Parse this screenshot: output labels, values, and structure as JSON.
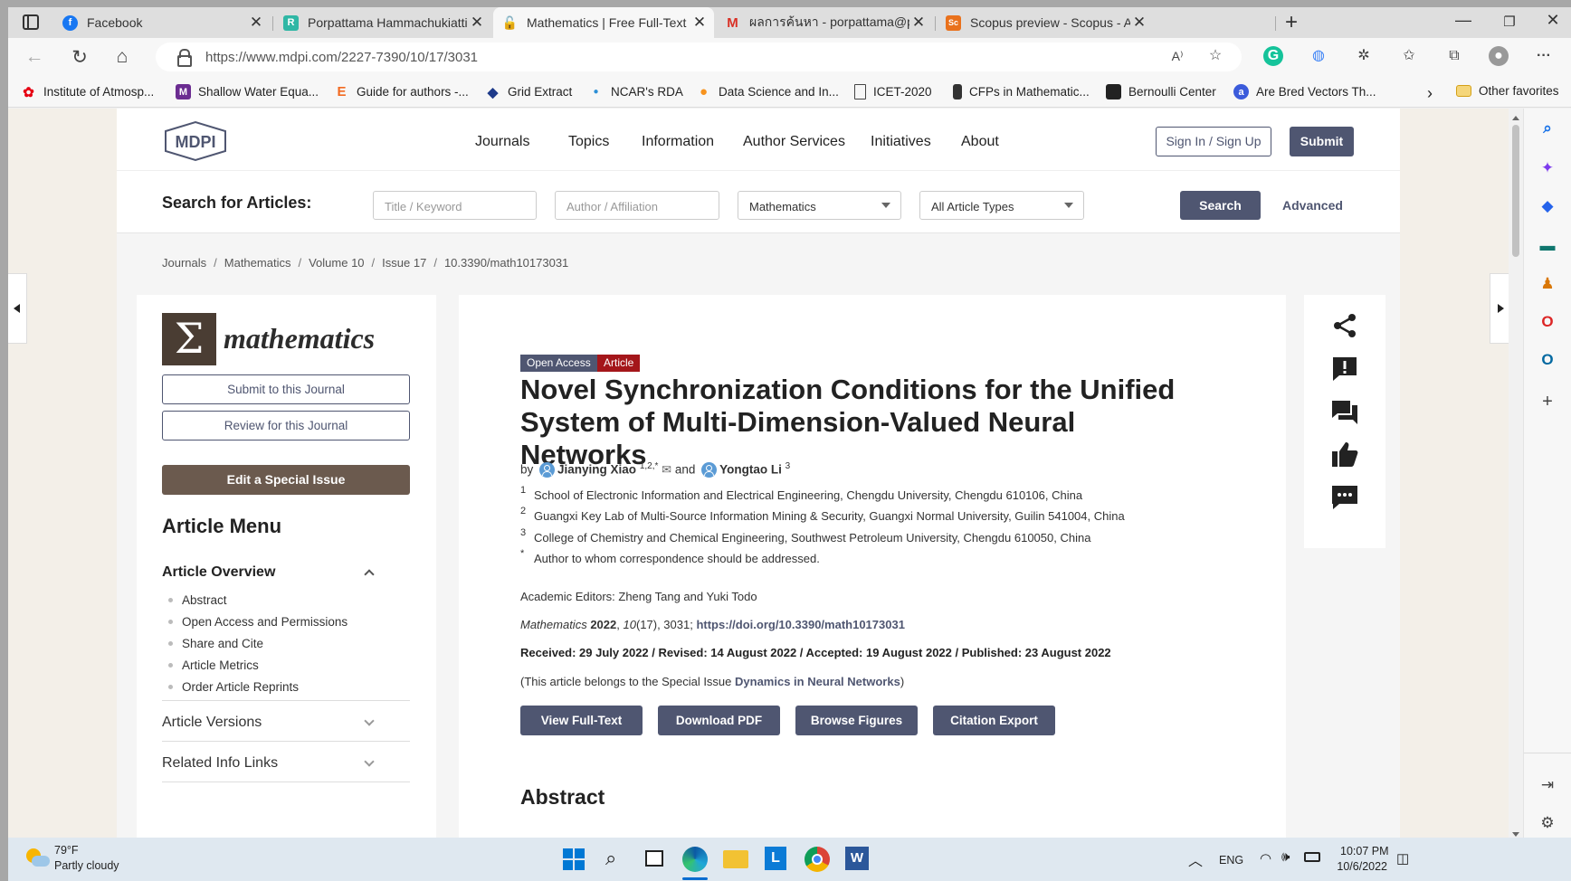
{
  "browser": {
    "tabs": [
      {
        "title": "Facebook",
        "icon": "facebook-icon",
        "color": "#1877f2",
        "glyph": "f"
      },
      {
        "title": "Porpattama Hammachukiattikul |",
        "icon": "researchgate-icon",
        "color": "#2fb7a5",
        "glyph": "R"
      },
      {
        "title": "Mathematics | Free Full-Text | Nc",
        "icon": "page-icon",
        "color": "#555555",
        "glyph": ""
      },
      {
        "title": "ผลการค้นหา - porpattama@pkru.a",
        "icon": "gmail-icon",
        "color": "#d93025",
        "glyph": "M"
      },
      {
        "title": "Scopus preview - Scopus - Advar",
        "icon": "scopus-icon",
        "color": "#e9711c",
        "glyph": "Sc"
      }
    ],
    "url": "https://www.mdpi.com/2227-7390/10/17/3031",
    "favorites": [
      {
        "label": "Institute of Atmosp...",
        "color": "#e60012",
        "glyph": "✿"
      },
      {
        "label": "Shallow Water Equa...",
        "color": "#6b2c91",
        "glyph": "M"
      },
      {
        "label": "Guide for authors -...",
        "color": "#f26a21",
        "glyph": "E"
      },
      {
        "label": "Grid Extract",
        "color": "#1e3a8a",
        "glyph": "◆"
      },
      {
        "label": "NCAR's RDA",
        "color": "#2c8fd6",
        "glyph": "●"
      },
      {
        "label": "Data Science and In...",
        "color": "#f7931e",
        "glyph": "●"
      },
      {
        "label": "ICET-2020",
        "color": "#ffffff",
        "glyph": ""
      },
      {
        "label": "CFPs in Mathematic...",
        "color": "#222222",
        "glyph": ""
      },
      {
        "label": "Bernoulli Center",
        "color": "#222222",
        "glyph": ""
      },
      {
        "label": "Are Bred Vectors Th...",
        "color": "#3b5bdb",
        "glyph": "a"
      }
    ],
    "other_favorites": "Other favorites"
  },
  "site": {
    "brand": "MDPI",
    "nav": [
      "Journals",
      "Topics",
      "Information",
      "Author Services",
      "Initiatives",
      "About"
    ],
    "sign_in": "Sign In / Sign Up",
    "submit": "Submit",
    "search": {
      "label": "Search for Articles:",
      "title_placeholder": "Title / Keyword",
      "author_placeholder": "Author / Affiliation",
      "journal_value": "Mathematics",
      "type_value": "All Article Types",
      "button": "Search",
      "advanced": "Advanced"
    },
    "breadcrumb": [
      "Journals",
      "Mathematics",
      "Volume 10",
      "Issue 17",
      "10.3390/math10173031"
    ]
  },
  "sidebar": {
    "journal_glyph": "Σ",
    "journal_name": "mathematics",
    "submit_btn": "Submit to this Journal",
    "review_btn": "Review for this Journal",
    "special_btn": "Edit a Special Issue",
    "menu_title": "Article Menu",
    "overview_title": "Article Overview",
    "overview_items": [
      "Abstract",
      "Open Access and Permissions",
      "Share and Cite",
      "Article Metrics",
      "Order Article Reprints"
    ],
    "versions": "Article Versions",
    "related": "Related Info Links"
  },
  "article": {
    "badge_open": "Open Access",
    "badge_type": "Article",
    "title": "Novel Synchronization Conditions for the Unified System of Multi-Dimension-Valued Neural Networks",
    "by": "by",
    "author1": "Jianying Xiao",
    "author1_sup": "1,2,*",
    "and": "and",
    "author2": "Yongtao Li",
    "author2_sup": "3",
    "affiliations": [
      {
        "mark": "1",
        "text": "School of Electronic Information and Electrical Engineering, Chengdu University, Chengdu 610106, China"
      },
      {
        "mark": "2",
        "text": "Guangxi Key Lab of Multi-Source Information Mining & Security, Guangxi Normal University, Guilin 541004, China"
      },
      {
        "mark": "3",
        "text": "College of Chemistry and Chemical Engineering, Southwest Petroleum University, Chengdu 610050, China"
      },
      {
        "mark": "*",
        "text": "Author to whom correspondence should be addressed."
      }
    ],
    "editors": "Academic Editors: Zheng Tang and Yuki Todo",
    "cite_journal": "Mathematics",
    "cite_year": "2022",
    "cite_rest_a": ", ",
    "cite_volume": "10",
    "cite_rest_b": "(17), 3031; ",
    "doi": "https://doi.org/10.3390/math10173031",
    "dates": "Received: 29 July 2022 / Revised: 14 August 2022 / Accepted: 19 August 2022 / Published: 23 August 2022",
    "special_prefix": "(This article belongs to the Special Issue ",
    "special_name": "Dynamics in Neural Networks",
    "special_suffix": ")",
    "buttons": [
      "View Full-Text",
      "Download PDF",
      "Browse Figures",
      "Citation Export"
    ],
    "abstract_heading": "Abstract"
  },
  "taskbar": {
    "temp": "79°F",
    "weather": "Partly cloudy",
    "lang": "ENG",
    "time": "10:07 PM",
    "date": "10/6/2022"
  },
  "colors": {
    "accent": "#4f5671",
    "badge_open": "#4f5671",
    "badge_article": "#a4161a",
    "brown": "#6b5a4e"
  }
}
